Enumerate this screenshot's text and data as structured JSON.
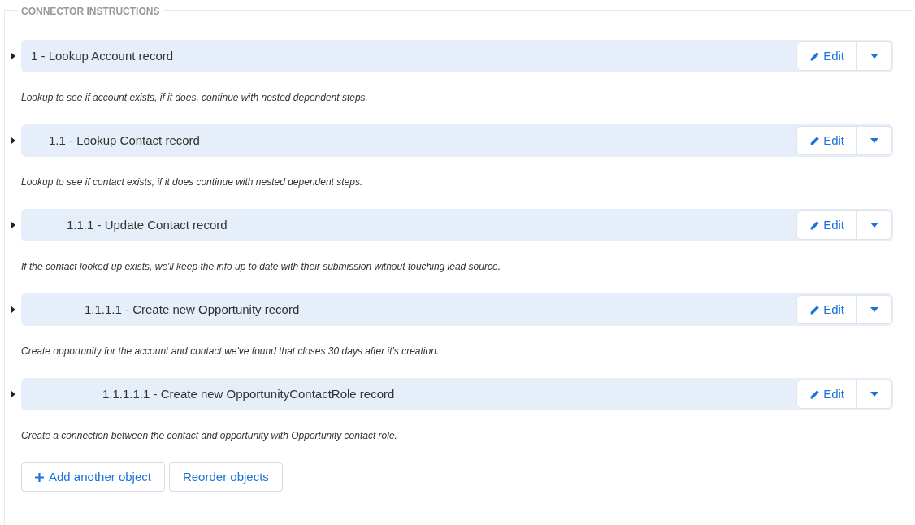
{
  "section": {
    "legend": "CONNECTOR INSTRUCTIONS"
  },
  "steps": [
    {
      "title": "1 - Lookup Account record",
      "expanded": false,
      "description": "Lookup to see if account exists, if it does, continue with nested dependent steps.",
      "edit_label": "Edit",
      "children": [
        {
          "title": "1.1 - Lookup Contact record",
          "expanded": false,
          "description": "Lookup to see if contact exists, if it does continue with nested dependent steps.",
          "edit_label": "Edit",
          "children": [
            {
              "title": "1.1.1 - Update Contact record",
              "expanded": false,
              "description": "If the contact looked up exists, we'll keep the info up to date with their submission without touching lead source.",
              "edit_label": "Edit",
              "children": [
                {
                  "title": "1.1.1.1 - Create new Opportunity record",
                  "expanded": false,
                  "description": "Create opportunity for the account and contact we've found that closes 30 days after it's creation.",
                  "edit_label": "Edit",
                  "children": [
                    {
                      "title": "1.1.1.1.1 - Create new OpportunityContactRole record",
                      "expanded": false,
                      "description": "Create a connection between the contact and opportunity with Opportunity contact role.",
                      "edit_label": "Edit"
                    }
                  ]
                }
              ]
            }
          ]
        }
      ]
    }
  ],
  "buttons": [
    {
      "kind": "add",
      "label": "Add another object"
    },
    {
      "kind": "plain",
      "label": "Reorder objects"
    }
  ]
}
